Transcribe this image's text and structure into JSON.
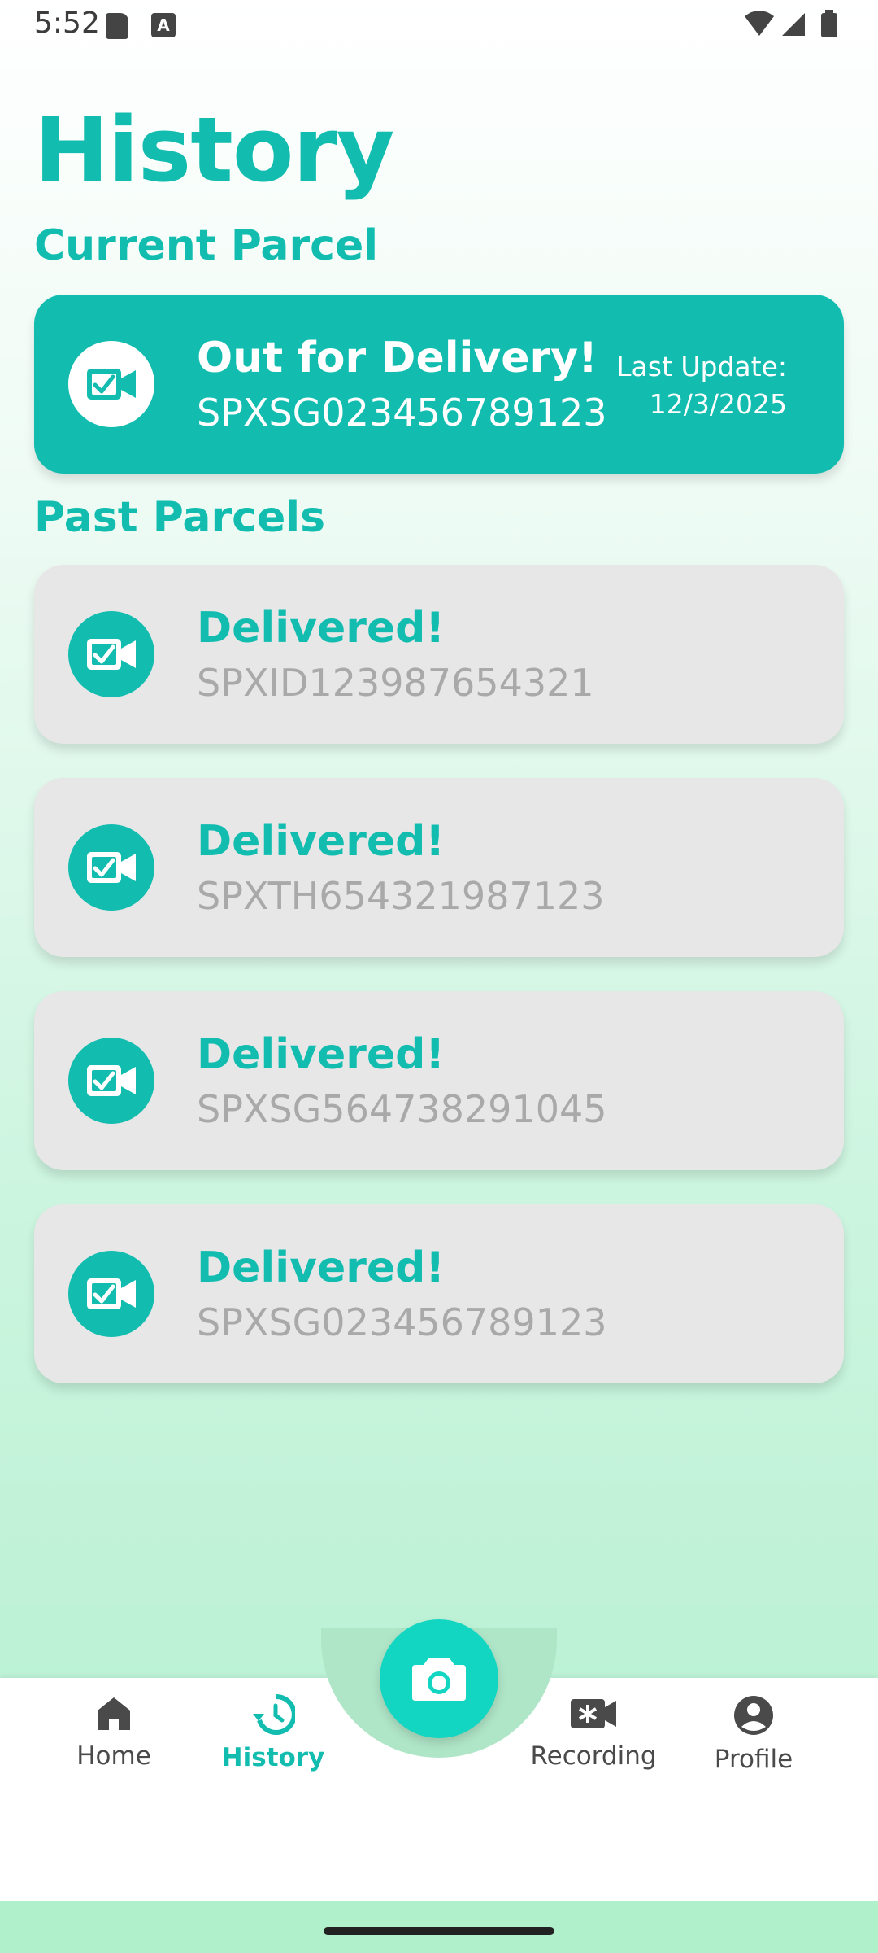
{
  "status_bar": {
    "time": "5:52",
    "a_badge": "A"
  },
  "page": {
    "title": "History",
    "current_section": "Current Parcel",
    "past_section": "Past Parcels"
  },
  "current_parcel": {
    "status": "Out for Delivery!",
    "code": "SPXSG023456789123",
    "last_update_label": "Last Update:",
    "last_update_date": "12/3/2025"
  },
  "past_parcels": [
    {
      "status": "Delivered!",
      "code": "SPXID123987654321"
    },
    {
      "status": "Delivered!",
      "code": "SPXTH654321987123"
    },
    {
      "status": "Delivered!",
      "code": "SPXSG564738291045"
    },
    {
      "status": "Delivered!",
      "code": "SPXSG023456789123"
    }
  ],
  "nav": {
    "home": "Home",
    "history": "History",
    "recording": "Recording",
    "profile": "Profile"
  },
  "icons": [
    "sd-card-icon",
    "a-notification-icon",
    "wifi-icon",
    "signal-icon",
    "battery-icon",
    "video-check-icon",
    "home-icon",
    "history-icon",
    "camera-icon",
    "recording-icon",
    "profile-icon"
  ],
  "colors": {
    "accent": "#12bdb0",
    "fab": "#12d6c2",
    "card_past": "#e7e7e7",
    "code_past": "#a9a9a9"
  }
}
